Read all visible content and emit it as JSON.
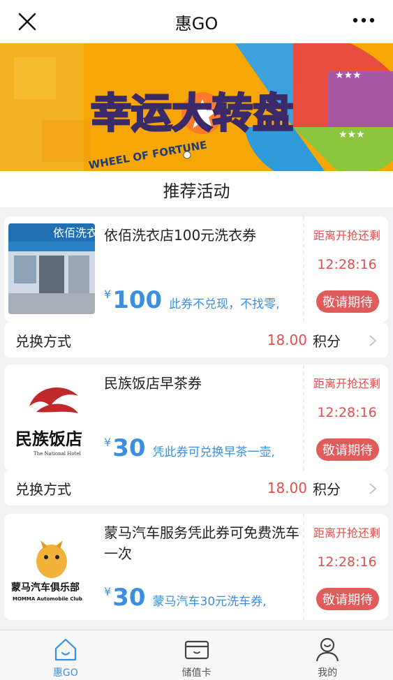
{
  "header": {
    "title": "惠GO"
  },
  "banner": {
    "title_cn": "幸运大转盘",
    "title_en": "WHEEL OF FORTUNE",
    "slide_count": 2,
    "active_slide": 2
  },
  "section": {
    "title": "推荐活动"
  },
  "coupons": [
    {
      "name": "依佰洗衣店100元洗衣券",
      "thumb_text": "依佰洗衣",
      "price_symbol": "¥",
      "price": "100",
      "desc": "此券不兑现，不找零,",
      "countdown_label": "距离开抢还剩",
      "countdown": "12:28:16",
      "button": "敬请期待",
      "redeem_label": "兑换方式",
      "points": "18.00",
      "points_unit": "积分"
    },
    {
      "name": "民族饭店早茶券",
      "thumb_text": "民族饭店",
      "thumb_sub": "The National Hotel",
      "price_symbol": "¥",
      "price": "30",
      "desc": "凭此券可兑换早茶一壶,",
      "countdown_label": "距离开抢还剩",
      "countdown": "12:28:16",
      "button": "敬请期待",
      "redeem_label": "兑换方式",
      "points": "18.00",
      "points_unit": "积分"
    },
    {
      "name": "蒙马汽车服务凭此券可免费洗车一次",
      "thumb_text": "蒙马汽车俱乐部",
      "thumb_sub": "MOMMA Automobile Club",
      "price_symbol": "¥",
      "price": "30",
      "desc": "蒙马汽车30元洗车券,",
      "countdown_label": "距离开抢还剩",
      "countdown": "12:28:16",
      "button": "敬请期待"
    }
  ],
  "tabbar": {
    "items": [
      {
        "label": "惠GO",
        "icon": "home-icon",
        "active": true
      },
      {
        "label": "储值卡",
        "icon": "card-icon",
        "active": false
      },
      {
        "label": "我的",
        "icon": "user-icon",
        "active": false
      }
    ]
  },
  "colors": {
    "accent_blue": "#3a8fe0",
    "accent_red": "#e14e4e",
    "button_red": "#e25b5b",
    "background": "#f2f2f4"
  }
}
